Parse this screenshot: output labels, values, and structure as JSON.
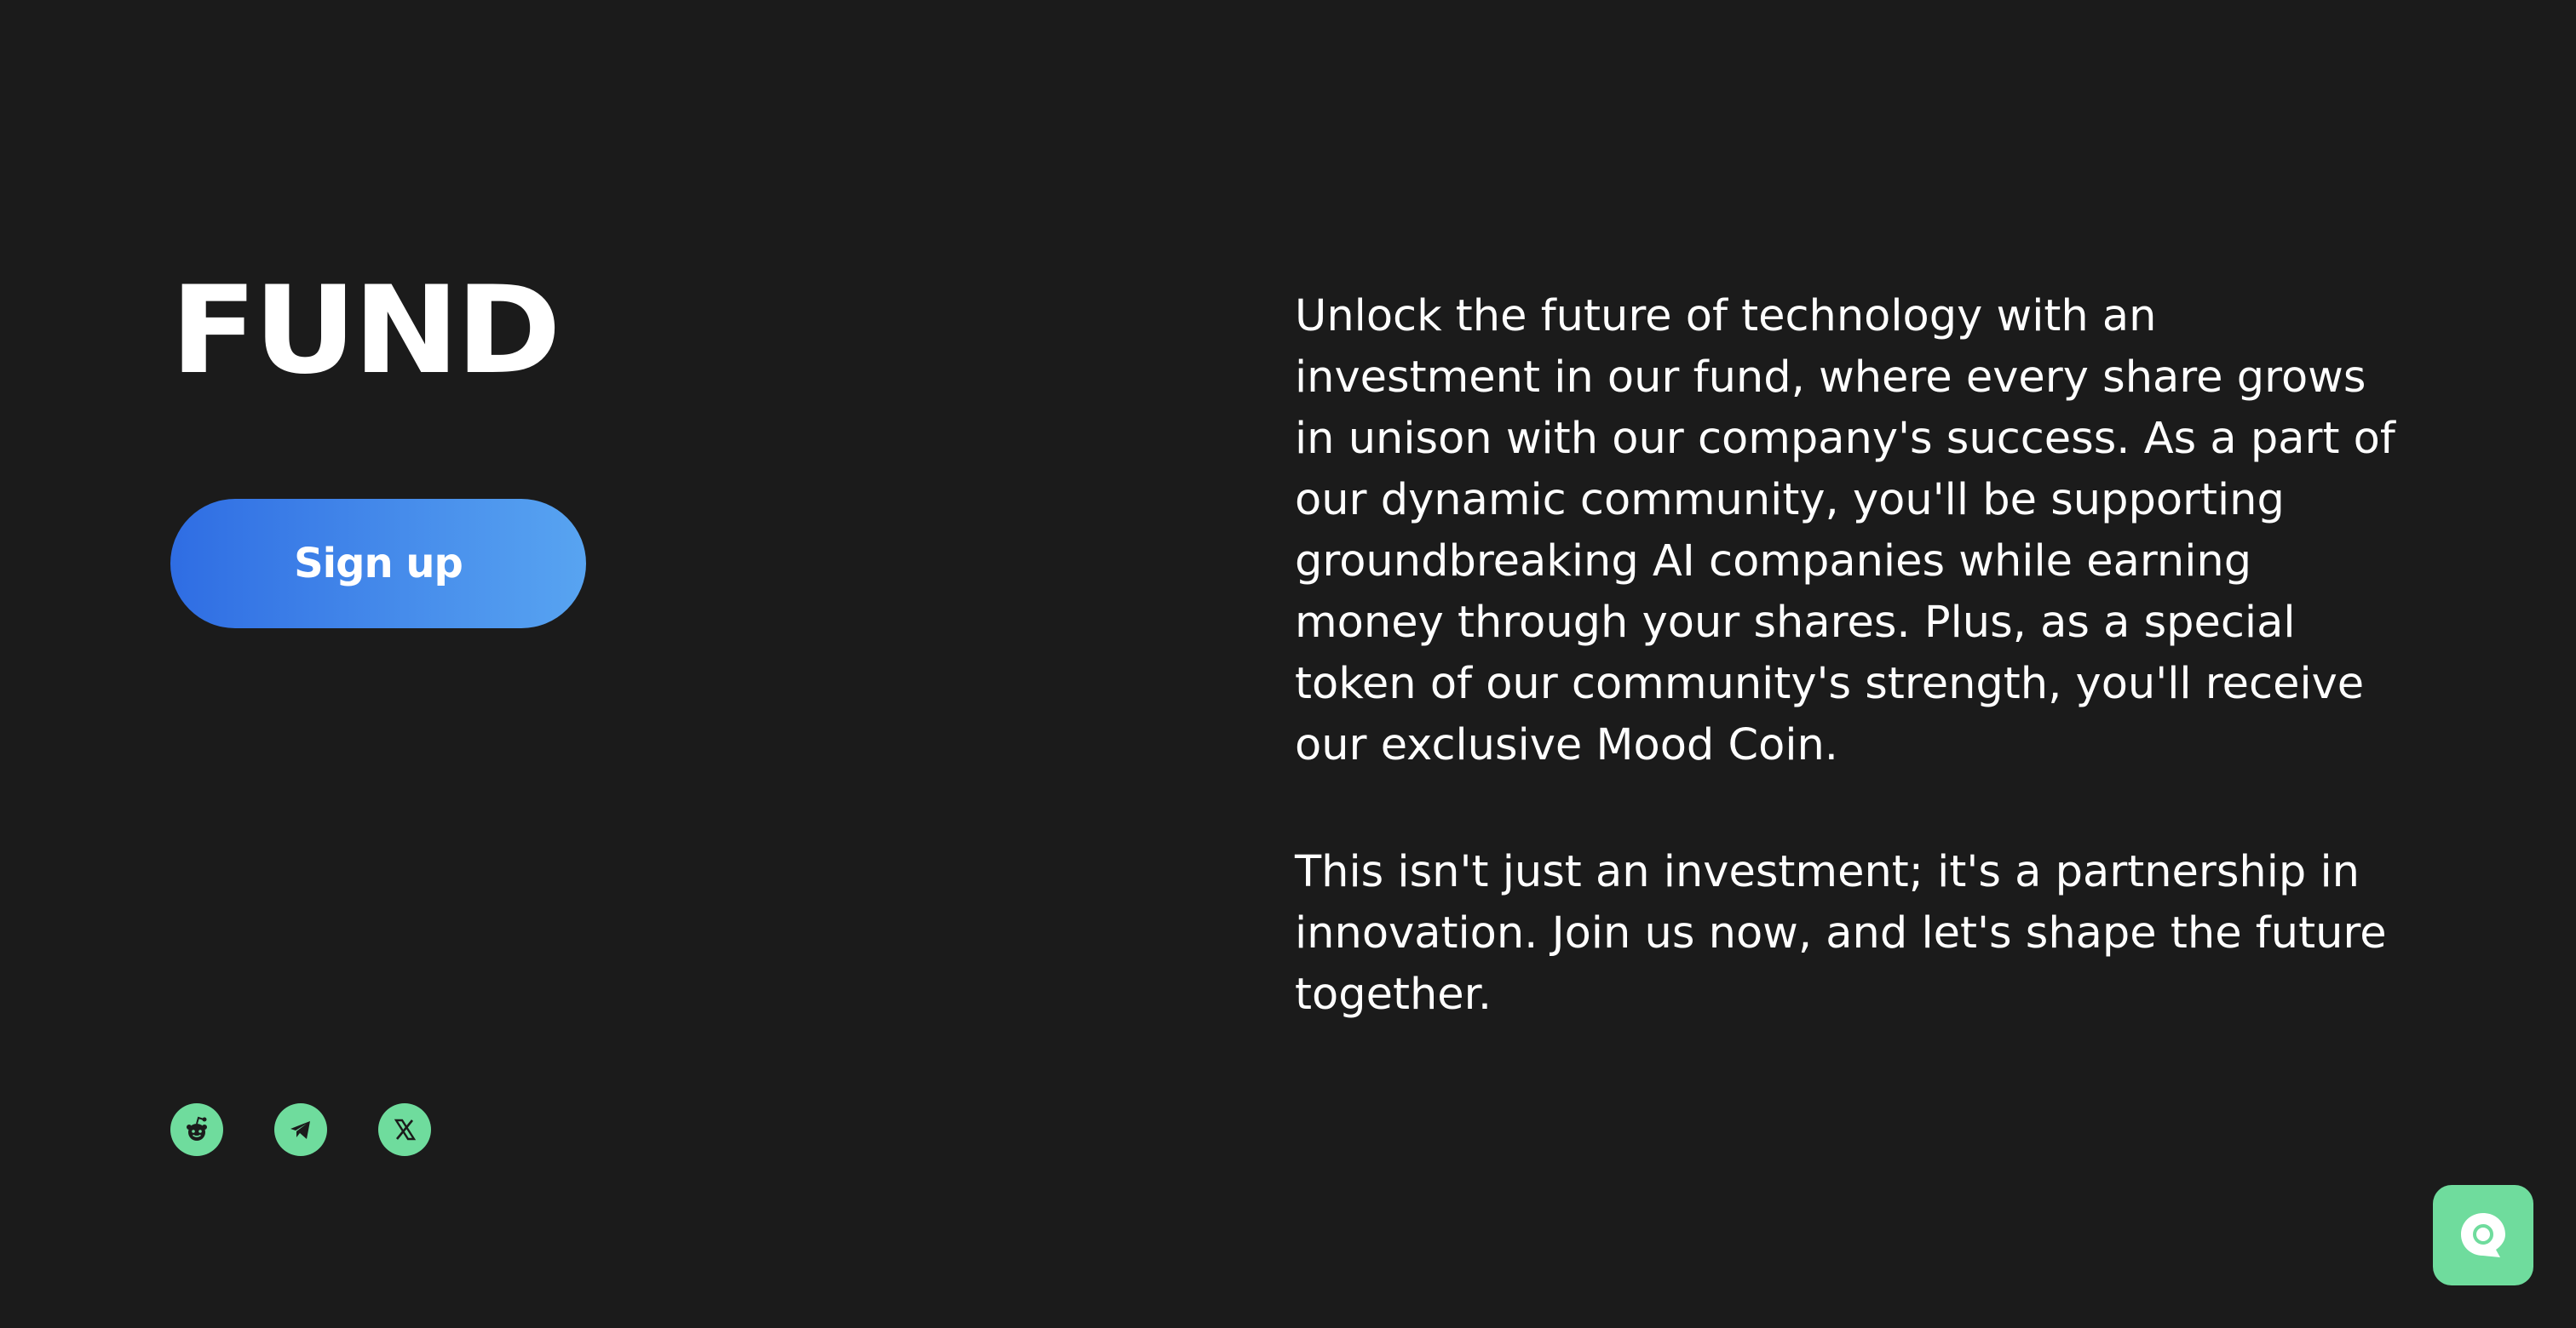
{
  "brand": {
    "title": "FUND"
  },
  "hero": {
    "signup_label": "Sign up"
  },
  "description": {
    "paragraph_1": "Unlock the future of technology with an investment in our fund, where every share grows in unison with our company's success. As a part of our dynamic community, you'll be supporting groundbreaking AI companies while earning money through your shares. Plus, as a special token of our community's strength, you'll receive our exclusive Mood Coin.",
    "paragraph_2": "This isn't just an investment; it's a partnership in innovation. Join us now, and let's shape the future together."
  },
  "socials": [
    {
      "icon": "reddit-icon"
    },
    {
      "icon": "telegram-icon"
    },
    {
      "icon": "x-icon"
    }
  ],
  "chat_widget": {
    "icon": "chat-bubble-icon"
  },
  "colors": {
    "background": "#1b1b1b",
    "accent_green": "#6fdc9d",
    "button_gradient_start": "#2f6de3",
    "button_gradient_end": "#58a4f1",
    "text": "#ffffff"
  }
}
